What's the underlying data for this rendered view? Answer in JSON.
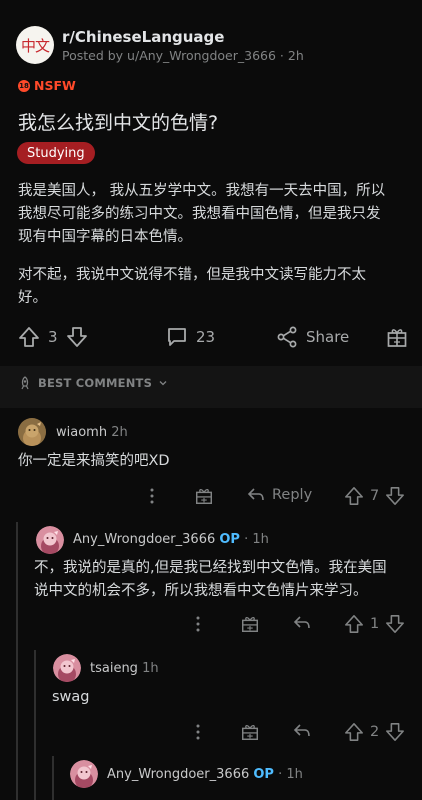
{
  "post": {
    "subreddit": "r/ChineseLanguage",
    "subreddit_icon_text": "中文",
    "posted_by": "Posted by u/Any_Wrongdoer_3666 · 2h",
    "nsfw_label": "NSFW",
    "title": "我怎么找到中文的色情?",
    "flair": "Studying",
    "body_lines": [
      "我是美国人， 我从五岁学中文。我想有一天去中国，所以",
      "我想尽可能多的练习中文。我想看中国色情，但是我只发",
      "现有中国字幕的日本色情。"
    ],
    "body_lines_2": [
      "对不起，我说中文说得不错，但是我中文读写能力不太",
      "好。"
    ],
    "vote_count": "3",
    "comment_count": "23",
    "share_label": "Share"
  },
  "sort": {
    "label": "BEST COMMENTS"
  },
  "comments": [
    {
      "author": "wiaomh",
      "time": "2h",
      "text": "你一定是来搞笑的吧XD",
      "reply_label": "Reply",
      "votes": "7"
    },
    {
      "author": "Any_Wrongdoer_3666",
      "op_label": "OP",
      "time": "· 1h",
      "text_lines": [
        "不，我说的是真的,但是我已经找到中文色情。我在美国",
        "说中文的机会不多，所以我想看中文色情片来学习。"
      ],
      "votes": "1"
    },
    {
      "author": "tsaieng",
      "time": "1h",
      "text": "swag",
      "votes": "2"
    },
    {
      "author": "Any_Wrongdoer_3666",
      "op_label": "OP",
      "time": "· 1h"
    }
  ],
  "colors": {
    "background": "#0b0b0b",
    "nsfw": "#ff4a2a",
    "flair_bg": "#a51e22",
    "op_blue": "#4fbcff",
    "muted": "#818384"
  }
}
